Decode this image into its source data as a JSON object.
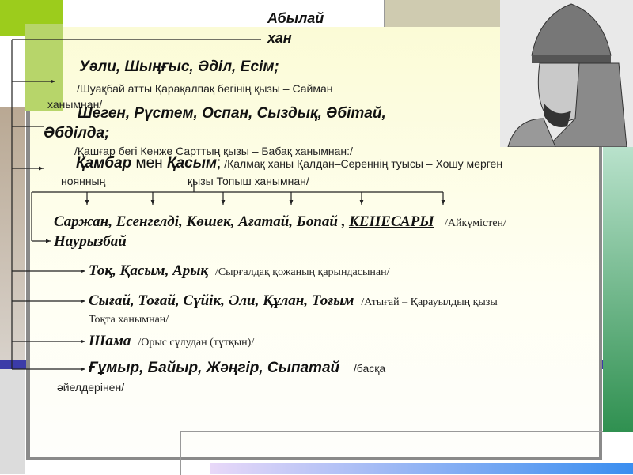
{
  "root": {
    "line1": "Абылай",
    "line2": "хан"
  },
  "branches": [
    {
      "names": "Уәли, Шыңғыс, Әділ, Есім;",
      "mother_line1": "/Шуақбай атты Қарақалпақ бегінің қызы – Сайман",
      "mother_line2": "ханымнан/"
    },
    {
      "names_line1": "Шеген, Рүстем, Оспан, Сыздық, Әбітай,",
      "names_line2": "Әбділда;",
      "mother": "/Қашғар бегі Кенже Сарттың қызы – Бабақ ханымнан:/"
    },
    {
      "names_a": "Қамбар",
      "conj": " мен ",
      "names_b": "Қасым",
      "sep": ";",
      "mother_line1": " /Қалмақ ханы Қалдан–Сереннің туысы – Хошу мерген",
      "mother_line2a": "ноянның",
      "mother_line2b": "қызы Топыш ханымнан/"
    },
    {
      "names": "Саржан, Есенгелді, Көшек, Ағатай, Бопай ,",
      "highlight": "КЕНЕСАРЫ",
      "mother": "/Айкүмістен/",
      "names_line2": "Наурызбай"
    },
    {
      "names": "Тоқ, Қасым, Арық",
      "mother": "/Сырғалдақ қожаның қарындасынан/"
    },
    {
      "names": "Сығай, Тоғай, Сүйік, Әли, Құлан, Тоғым",
      "mother_line1": "/Атығай – Қарауылдың қызы",
      "mother_line2": "Тоқта ханымнан/"
    },
    {
      "names": "Шама",
      "mother": "/Орыс сұлудан (тұтқын)/"
    },
    {
      "names": "Ғұмыр, Байыр, Жәңгір, Сыпатай",
      "mother_line1": "/басқа",
      "mother_line2": "әйелдерінен/"
    }
  ],
  "portrait_icon": "warrior-portrait"
}
